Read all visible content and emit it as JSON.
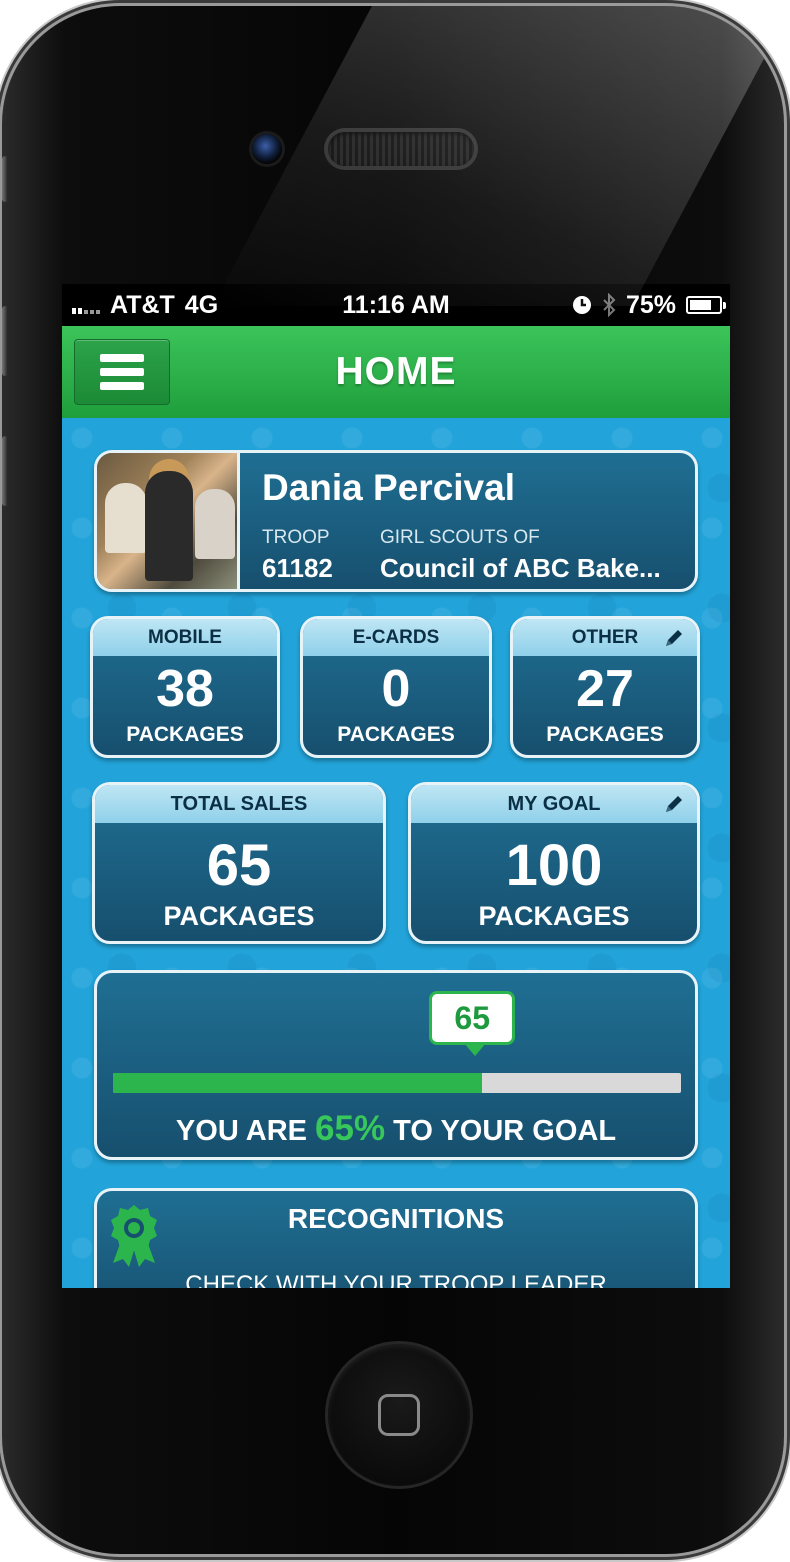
{
  "status_bar": {
    "carrier": "AT&T",
    "network": "4G",
    "time": "11:16 AM",
    "battery": "75%",
    "battery_level": 0.75
  },
  "navbar": {
    "title": "HOME"
  },
  "profile": {
    "name": "Dania Percival",
    "troop_label": "TROOP",
    "troop_number": "61182",
    "council_label": "GIRL SCOUTS OF",
    "council_name": "Council of ABC Bake..."
  },
  "stats": [
    {
      "label": "MOBILE",
      "value": "38",
      "unit": "PACKAGES",
      "editable": false
    },
    {
      "label": "E-CARDS",
      "value": "0",
      "unit": "PACKAGES",
      "editable": false
    },
    {
      "label": "OTHER",
      "value": "27",
      "unit": "PACKAGES",
      "editable": true
    }
  ],
  "totals": [
    {
      "label": "TOTAL SALES",
      "value": "65",
      "unit": "PACKAGES",
      "editable": false
    },
    {
      "label": "MY GOAL",
      "value": "100",
      "unit": "PACKAGES",
      "editable": true
    }
  ],
  "progress": {
    "bubble_value": "65",
    "fraction": 0.65,
    "prefix": "YOU ARE",
    "percent": "65%",
    "suffix": "TO YOUR GOAL"
  },
  "recognitions": {
    "title": "RECOGNITIONS",
    "subtitle": "CHECK WITH YOUR TROOP LEADER"
  },
  "colors": {
    "nav_green": "#2db54d",
    "background_blue": "#22a4da",
    "card_navy": "#174f6e",
    "progress_green": "#2db54d"
  },
  "icons": {
    "menu": "hamburger-menu-icon",
    "edit": "pencil-icon",
    "recognition": "ribbon-award-icon",
    "alarm": "clock-icon",
    "bluetooth": "bluetooth-icon"
  }
}
